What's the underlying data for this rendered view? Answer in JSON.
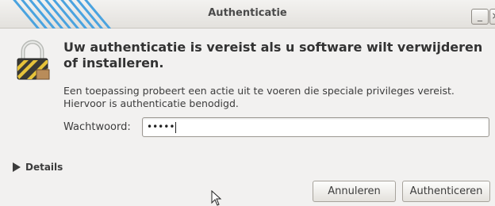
{
  "window": {
    "title": "Authenticatie",
    "minimize_label": "_",
    "close_label": "×"
  },
  "dialog": {
    "heading": "Uw authenticatie is vereist als u software wilt verwijderen of installeren.",
    "description": "Een toepassing probeert een actie uit te voeren die speciale privileges vereist. Hiervoor is authenticatie benodigd.",
    "password_label": "Wachtwoord:",
    "password_value": "•••••",
    "details_label": "Details",
    "cancel_label": "Annuleren",
    "authenticate_label": "Authenticeren"
  },
  "icons": {
    "dialog_icon": "padlock-icon",
    "expander": "triangle-right-icon",
    "pointer": "mouse-pointer-icon"
  },
  "colors": {
    "background": "#f2f1f0",
    "accent_stripes": "#4aa3df",
    "lock_stripe_yellow": "#e6c33a"
  }
}
